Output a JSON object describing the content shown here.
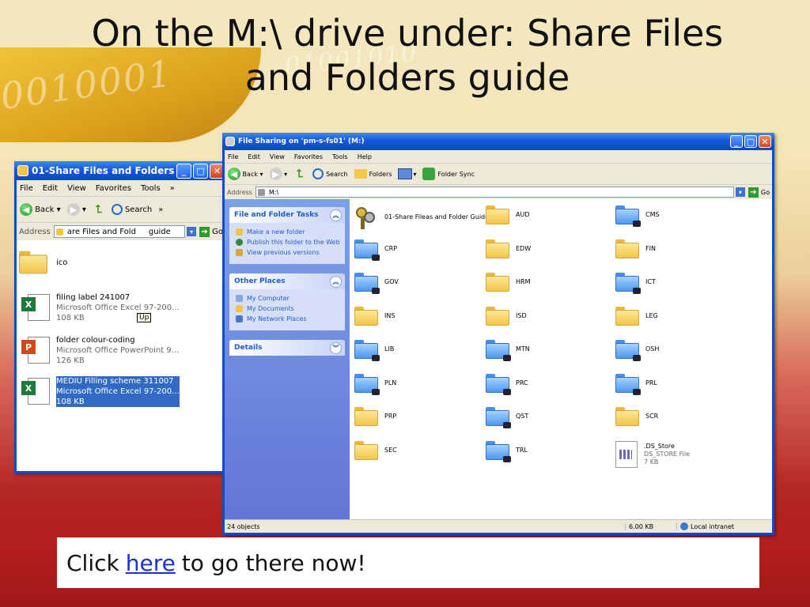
{
  "slide": {
    "title_line1": "On the M:\\ drive under: Share Files",
    "title_line2": "and Folders guide",
    "cta_before": "Click",
    "cta_link": "here",
    "cta_after": "to go there now!"
  },
  "background_binary": [
    "0010001",
    "01001010"
  ],
  "small_window": {
    "title": "01-Share Files and Folders...",
    "menu": [
      "File",
      "Edit",
      "View",
      "Favorites",
      "Tools",
      "»"
    ],
    "toolbar": {
      "back": "Back",
      "search": "Search",
      "more": "»"
    },
    "address_label": "Address",
    "address_value": "are Files and Fold",
    "address_value_tail": "guide",
    "go": "Go",
    "tooltip": "Up",
    "items": [
      {
        "name": "ico"
      },
      {
        "name": "filing label 241007",
        "type": "Microsoft Office Excel 97-200...",
        "size": "108 KB"
      },
      {
        "name": "folder colour-coding",
        "type": "Microsoft Office PowerPoint 9...",
        "size": "126 KB"
      },
      {
        "name": "MEDIU Filling scheme 311007",
        "type": "Microsoft Office Excel 97-200...",
        "size": "108 KB"
      }
    ]
  },
  "big_window": {
    "title": "File Sharing on 'pm-s-fs01' (M:)",
    "menu": [
      "File",
      "Edit",
      "View",
      "Favorites",
      "Tools",
      "Help"
    ],
    "toolbar": {
      "back": "Back",
      "search": "Search",
      "folders": "Folders",
      "folder_sync": "Folder Sync"
    },
    "address_label": "Address",
    "address_value": "M:\\",
    "go": "Go",
    "tasks": {
      "header": "File and Folder Tasks",
      "items": [
        "Make a new folder",
        "Publish this folder to the Web",
        "View previous versions"
      ]
    },
    "other_places": {
      "header": "Other Places",
      "items": [
        "My Computer",
        "My Documents",
        "My Network Places"
      ]
    },
    "details": {
      "header": "Details"
    },
    "folders": [
      {
        "name": "01-Share Fileas and Folder Guide",
        "icon": "keys"
      },
      {
        "name": "AUD",
        "icon": "folder"
      },
      {
        "name": "CMS",
        "icon": "shared-folder"
      },
      {
        "name": "CRP",
        "icon": "shared-folder"
      },
      {
        "name": "EDW",
        "icon": "folder"
      },
      {
        "name": "FIN",
        "icon": "folder"
      },
      {
        "name": "GOV",
        "icon": "shared-folder"
      },
      {
        "name": "HRM",
        "icon": "folder"
      },
      {
        "name": "ICT",
        "icon": "shared-folder"
      },
      {
        "name": "INS",
        "icon": "folder"
      },
      {
        "name": "ISD",
        "icon": "folder"
      },
      {
        "name": "LEG",
        "icon": "folder"
      },
      {
        "name": "LIB",
        "icon": "shared-folder"
      },
      {
        "name": "MTN",
        "icon": "shared-folder"
      },
      {
        "name": "OSH",
        "icon": "shared-folder"
      },
      {
        "name": "PLN",
        "icon": "shared-folder"
      },
      {
        "name": "PRC",
        "icon": "shared-folder"
      },
      {
        "name": "PRL",
        "icon": "shared-folder"
      },
      {
        "name": "PRP",
        "icon": "folder"
      },
      {
        "name": "QST",
        "icon": "shared-folder"
      },
      {
        "name": "SCR",
        "icon": "folder"
      },
      {
        "name": "SEC",
        "icon": "folder"
      },
      {
        "name": "TRL",
        "icon": "shared-folder"
      },
      {
        "name": ".DS_Store",
        "icon": "ds-store-file",
        "type": "DS_STORE File",
        "size": "7 KB"
      }
    ],
    "status": {
      "objects": "24 objects",
      "size": "6.00 KB",
      "zone": "Local intranet"
    }
  }
}
